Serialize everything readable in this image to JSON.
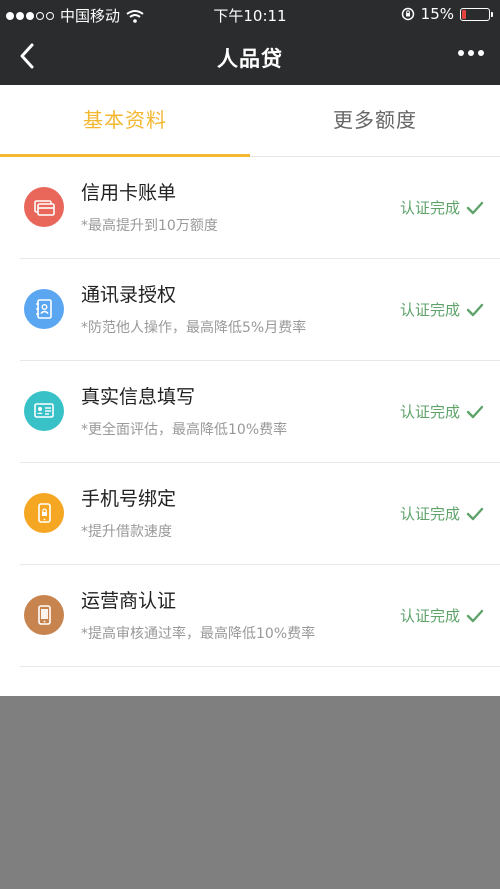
{
  "status_bar": {
    "carrier": "中国移动",
    "time": "下午10:11",
    "battery_percent": "15%",
    "battery_level": 0.15,
    "signal_dots_filled": 3,
    "signal_dots_total": 5
  },
  "nav": {
    "title": "人品贷",
    "back_icon": "chevron-left-icon",
    "more_icon": "more-dots-icon"
  },
  "tabs": [
    {
      "label": "基本资料",
      "active": true
    },
    {
      "label": "更多额度",
      "active": false
    }
  ],
  "colors": {
    "accent": "#f4b731",
    "success": "#5fa36b",
    "bar": "#2b2c2e",
    "overlay": "#7f7f7f"
  },
  "items": [
    {
      "title": "信用卡账单",
      "desc": "*最高提升到10万额度",
      "status": "认证完成",
      "icon": "credit-card-icon",
      "color": "#e8675a"
    },
    {
      "title": "通讯录授权",
      "desc": "*防范他人操作，最高降低5%月费率",
      "status": "认证完成",
      "icon": "contacts-book-icon",
      "color": "#5aa6f0"
    },
    {
      "title": "真实信息填写",
      "desc": "*更全面评估，最高降低10%费率",
      "status": "认证完成",
      "icon": "id-card-icon",
      "color": "#39c1c8"
    },
    {
      "title": "手机号绑定",
      "desc": "*提升借款速度",
      "status": "认证完成",
      "icon": "phone-lock-icon",
      "color": "#f5a623"
    },
    {
      "title": "运营商认证",
      "desc": "*提高审核通过率，最高降低10%费率",
      "status": "认证完成",
      "icon": "mobile-phone-icon",
      "color": "#c8844f"
    }
  ]
}
